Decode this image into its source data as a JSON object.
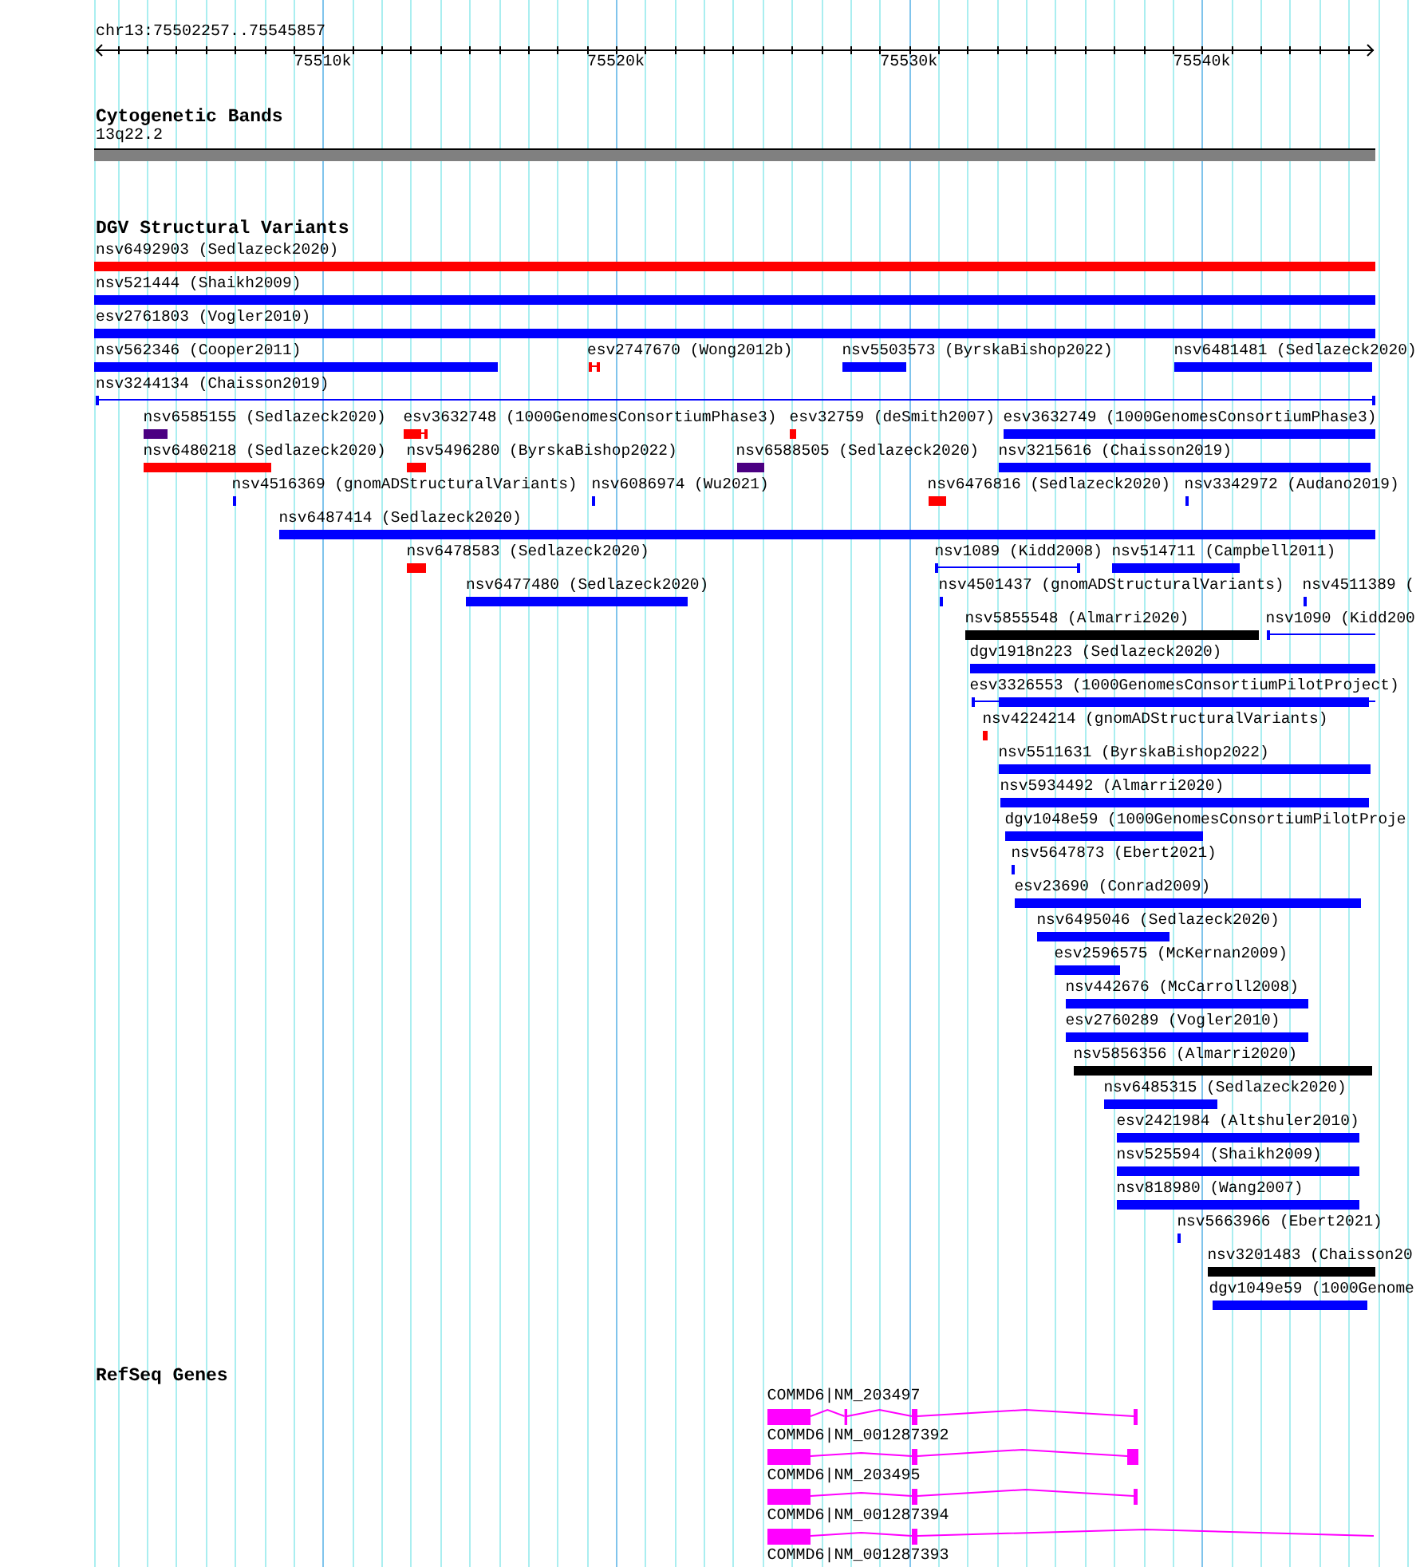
{
  "ruler": {
    "location": "chr13:75502257..75545857",
    "tick_labels": [
      "75510k",
      "75520k",
      "75530k",
      "75540k"
    ]
  },
  "cytogenetic_bands": {
    "title": "Cytogenetic Bands",
    "band": {
      "label": "13q22.2"
    }
  },
  "dgv_structural_variants": {
    "title": "DGV Structural Variants",
    "rows": [
      {
        "features": [
          {
            "label": "nsv6492903 (Sedlazeck2020)",
            "kind": "bar",
            "color": "#ff0000"
          }
        ]
      },
      {
        "features": [
          {
            "label": "nsv521444 (Shaikh2009)",
            "kind": "bar",
            "color": "#0000ff"
          }
        ]
      },
      {
        "features": [
          {
            "label": "esv2761803 (Vogler2010)",
            "kind": "bar",
            "color": "#0000ff"
          }
        ]
      },
      {
        "features": [
          {
            "label": "nsv562346 (Cooper2011)",
            "kind": "bar",
            "color": "#0000ff"
          },
          {
            "label": "esv2747670 (Wong2012b)",
            "kind": "line",
            "color": "#ff0000"
          },
          {
            "label": "nsv5503573 (ByrskaBishop2022)",
            "kind": "bar",
            "color": "#0000ff"
          },
          {
            "label": "nsv6481481 (Sedlazeck2020)",
            "kind": "bar",
            "color": "#0000ff"
          }
        ]
      },
      {
        "features": [
          {
            "label": "nsv3244134 (Chaisson2019)",
            "kind": "line",
            "color": "#0000ff"
          }
        ]
      },
      {
        "features": [
          {
            "label": "nsv6585155 (Sedlazeck2020)",
            "kind": "bar",
            "color": "#4b0082"
          },
          {
            "label": "esv3632748 (1000GenomesConsortiumPhase3)",
            "kind": "mixed",
            "color": "#ff0000"
          },
          {
            "label": "esv32759 (deSmith2007)",
            "kind": "bar",
            "color": "#ff0000"
          },
          {
            "label": "esv3632749 (1000GenomesConsortiumPhase3)",
            "kind": "bar",
            "color": "#0000ff"
          }
        ]
      },
      {
        "features": [
          {
            "label": "nsv6480218 (Sedlazeck2020)",
            "kind": "bar",
            "color": "#ff0000"
          },
          {
            "label": "nsv5496280 (ByrskaBishop2022)",
            "kind": "bar",
            "color": "#ff0000"
          },
          {
            "label": "nsv6588505 (Sedlazeck2020)",
            "kind": "bar",
            "color": "#4b0082"
          },
          {
            "label": "nsv3215616 (Chaisson2019)",
            "kind": "bar",
            "color": "#0000ff"
          }
        ]
      },
      {
        "features": [
          {
            "label": "nsv4516369 (gnomADStructuralVariants)",
            "kind": "bar",
            "color": "#0000ff"
          },
          {
            "label": "nsv6086974 (Wu2021)",
            "kind": "bar",
            "color": "#0000ff"
          },
          {
            "label": "nsv6476816 (Sedlazeck2020)",
            "kind": "bar",
            "color": "#ff0000"
          },
          {
            "label": "nsv3342972 (Audano2019)",
            "kind": "bar",
            "color": "#0000ff"
          }
        ]
      },
      {
        "features": [
          {
            "label": "nsv6487414 (Sedlazeck2020)",
            "kind": "bar",
            "color": "#0000ff"
          }
        ]
      },
      {
        "features": [
          {
            "label": "nsv6478583 (Sedlazeck2020)",
            "kind": "bar",
            "color": "#ff0000"
          },
          {
            "label": "nsv1089 (Kidd2008)",
            "kind": "line",
            "color": "#0000ff"
          },
          {
            "label": "nsv514711 (Campbell2011)",
            "kind": "bar",
            "color": "#0000ff"
          }
        ]
      },
      {
        "features": [
          {
            "label": "nsv6477480 (Sedlazeck2020)",
            "kind": "bar",
            "color": "#0000ff"
          },
          {
            "label": "nsv4501437 (gnomADStructuralVariants)",
            "kind": "bar",
            "color": "#0000ff"
          },
          {
            "label": "nsv4511389 (",
            "kind": "bar",
            "color": "#0000ff"
          }
        ]
      },
      {
        "features": [
          {
            "label": "nsv5855548 (Almarri2020)",
            "kind": "bar",
            "color": "#000000"
          },
          {
            "label": "nsv1090 (Kidd200",
            "kind": "line",
            "color": "#0000ff"
          }
        ]
      },
      {
        "features": [
          {
            "label": "dgv1918n223 (Sedlazeck2020)",
            "kind": "bar",
            "color": "#0000ff"
          }
        ]
      },
      {
        "features": [
          {
            "label": "esv3326553 (1000GenomesConsortiumPilotProject)",
            "kind": "mixed",
            "color": "#0000ff"
          }
        ]
      },
      {
        "features": [
          {
            "label": "nsv4224214 (gnomADStructuralVariants)",
            "kind": "bar",
            "color": "#ff0000"
          }
        ]
      },
      {
        "features": [
          {
            "label": "nsv5511631 (ByrskaBishop2022)",
            "kind": "bar",
            "color": "#0000ff"
          }
        ]
      },
      {
        "features": [
          {
            "label": "nsv5934492 (Almarri2020)",
            "kind": "bar",
            "color": "#0000ff"
          }
        ]
      },
      {
        "features": [
          {
            "label": "dgv1048e59 (1000GenomesConsortiumPilotProje",
            "kind": "bar",
            "color": "#0000ff"
          }
        ]
      },
      {
        "features": [
          {
            "label": "nsv5647873 (Ebert2021)",
            "kind": "bar",
            "color": "#0000ff"
          }
        ]
      },
      {
        "features": [
          {
            "label": "esv23690 (Conrad2009)",
            "kind": "bar",
            "color": "#0000ff"
          }
        ]
      },
      {
        "features": [
          {
            "label": "nsv6495046 (Sedlazeck2020)",
            "kind": "bar",
            "color": "#0000ff"
          }
        ]
      },
      {
        "features": [
          {
            "label": "esv2596575 (McKernan2009)",
            "kind": "bar",
            "color": "#0000ff"
          }
        ]
      },
      {
        "features": [
          {
            "label": "nsv442676 (McCarroll2008)",
            "kind": "bar",
            "color": "#0000ff"
          }
        ]
      },
      {
        "features": [
          {
            "label": "esv2760289 (Vogler2010)",
            "kind": "bar",
            "color": "#0000ff"
          }
        ]
      },
      {
        "features": [
          {
            "label": "nsv5856356 (Almarri2020)",
            "kind": "bar",
            "color": "#000000"
          }
        ]
      },
      {
        "features": [
          {
            "label": "nsv6485315 (Sedlazeck2020)",
            "kind": "bar",
            "color": "#0000ff"
          }
        ]
      },
      {
        "features": [
          {
            "label": "esv2421984 (Altshuler2010)",
            "kind": "bar",
            "color": "#0000ff"
          }
        ]
      },
      {
        "features": [
          {
            "label": "nsv525594 (Shaikh2009)",
            "kind": "bar",
            "color": "#0000ff"
          }
        ]
      },
      {
        "features": [
          {
            "label": "nsv818980 (Wang2007)",
            "kind": "bar",
            "color": "#0000ff"
          }
        ]
      },
      {
        "features": [
          {
            "label": "nsv5663966 (Ebert2021)",
            "kind": "bar",
            "color": "#0000ff"
          }
        ]
      },
      {
        "features": [
          {
            "label": "nsv3201483 (Chaisson20",
            "kind": "bar",
            "color": "#000000"
          }
        ]
      },
      {
        "features": [
          {
            "label": "dgv1049e59 (1000Genome",
            "kind": "bar",
            "color": "#0000ff"
          }
        ]
      }
    ]
  },
  "refseq_genes": {
    "title": "RefSeq Genes",
    "transcripts": [
      {
        "label": "COMMD6|NM_203497"
      },
      {
        "label": "COMMD6|NM_001287392"
      },
      {
        "label": "COMMD6|NM_203495"
      },
      {
        "label": "COMMD6|NM_001287394"
      },
      {
        "label": "COMMD6|NM_001287393"
      }
    ]
  }
}
